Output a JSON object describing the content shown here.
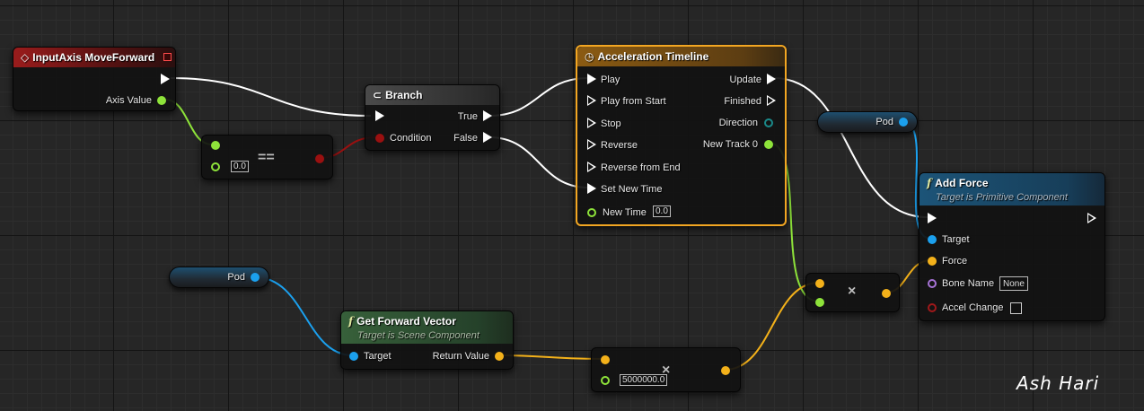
{
  "nodes": {
    "input_axis": {
      "title": "InputAxis MoveForward",
      "axis_value": "Axis Value"
    },
    "equals": {
      "op": "==",
      "value": "0.0"
    },
    "branch": {
      "title": "Branch",
      "condition": "Condition",
      "true_label": "True",
      "false_label": "False"
    },
    "timeline": {
      "title": "Acceleration Timeline",
      "play": "Play",
      "play_from_start": "Play from Start",
      "stop": "Stop",
      "reverse": "Reverse",
      "reverse_from_end": "Reverse from End",
      "set_new_time": "Set New Time",
      "new_time": "New Time",
      "new_time_value": "0.0",
      "update": "Update",
      "finished": "Finished",
      "direction": "Direction",
      "new_track": "New Track 0"
    },
    "pod_top": {
      "label": "Pod"
    },
    "pod_left": {
      "label": "Pod"
    },
    "add_force": {
      "title": "Add Force",
      "subtitle": "Target is Primitive Component",
      "target": "Target",
      "force": "Force",
      "bone_name": "Bone Name",
      "bone_value": "None",
      "accel_change": "Accel Change"
    },
    "get_forward": {
      "title": "Get Forward Vector",
      "subtitle": "Target is Scene Component",
      "target": "Target",
      "return_value": "Return Value"
    },
    "multiply_float": {
      "op": "×",
      "value": "5000000.0"
    },
    "multiply_vec": {
      "op": "×"
    }
  },
  "watermark": "Ash Hari",
  "colors": {
    "background": "#262626",
    "exec": "#ffffff",
    "float": "#8ee33a",
    "bool": "#9a1010",
    "object": "#1ba0ee",
    "vector": "#f3b11a",
    "name": "#a673d6",
    "selected": "#f2a622"
  },
  "icons": [
    "event-diamond-icon",
    "branch-icon",
    "timeline-clock-icon",
    "function-icon",
    "stop-square-icon"
  ]
}
